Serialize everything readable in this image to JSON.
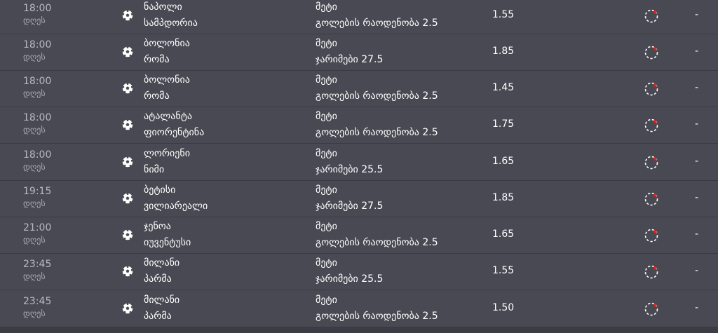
{
  "icons": {
    "sport": "football-icon",
    "status": "pending-status-icon",
    "status_accent": "#e2231a"
  },
  "colors": {
    "row_bg": "#484952",
    "separator": "#3a3b42",
    "text": "#ffffff",
    "muted_text": "#b8b9bf"
  },
  "rows": [
    {
      "time": "18:00",
      "day": "დღეს",
      "team1": "ნაპოლი",
      "team2": "სამპდორია",
      "market": "მეტი",
      "selection": "გოლების რაოდენობა 2.5",
      "odds": "1.55",
      "result": "-"
    },
    {
      "time": "18:00",
      "day": "დღეს",
      "team1": "ბოლონია",
      "team2": "რომა",
      "market": "მეტი",
      "selection": "ჯარიმები 27.5",
      "odds": "1.85",
      "result": "-"
    },
    {
      "time": "18:00",
      "day": "დღეს",
      "team1": "ბოლონია",
      "team2": "რომა",
      "market": "მეტი",
      "selection": "გოლების რაოდენობა 2.5",
      "odds": "1.45",
      "result": "-"
    },
    {
      "time": "18:00",
      "day": "დღეს",
      "team1": "ატალანტა",
      "team2": "ფიორენტინა",
      "market": "მეტი",
      "selection": "გოლების რაოდენობა 2.5",
      "odds": "1.75",
      "result": "-"
    },
    {
      "time": "18:00",
      "day": "დღეს",
      "team1": "ლორიენი",
      "team2": "ნიმი",
      "market": "მეტი",
      "selection": "ჯარიმები 25.5",
      "odds": "1.65",
      "result": "-"
    },
    {
      "time": "19:15",
      "day": "დღეს",
      "team1": "ბეტისი",
      "team2": "ვილიარეალი",
      "market": "მეტი",
      "selection": "ჯარიმები 27.5",
      "odds": "1.85",
      "result": "-"
    },
    {
      "time": "21:00",
      "day": "დღეს",
      "team1": "ჯენოა",
      "team2": "იუვენტუსი",
      "market": "მეტი",
      "selection": "გოლების რაოდენობა 2.5",
      "odds": "1.65",
      "result": "-"
    },
    {
      "time": "23:45",
      "day": "დღეს",
      "team1": "მილანი",
      "team2": "პარმა",
      "market": "მეტი",
      "selection": "ჯარიმები 25.5",
      "odds": "1.55",
      "result": "-"
    },
    {
      "time": "23:45",
      "day": "დღეს",
      "team1": "მილანი",
      "team2": "პარმა",
      "market": "მეტი",
      "selection": "გოლების რაოდენობა 2.5",
      "odds": "1.50",
      "result": "-"
    }
  ]
}
